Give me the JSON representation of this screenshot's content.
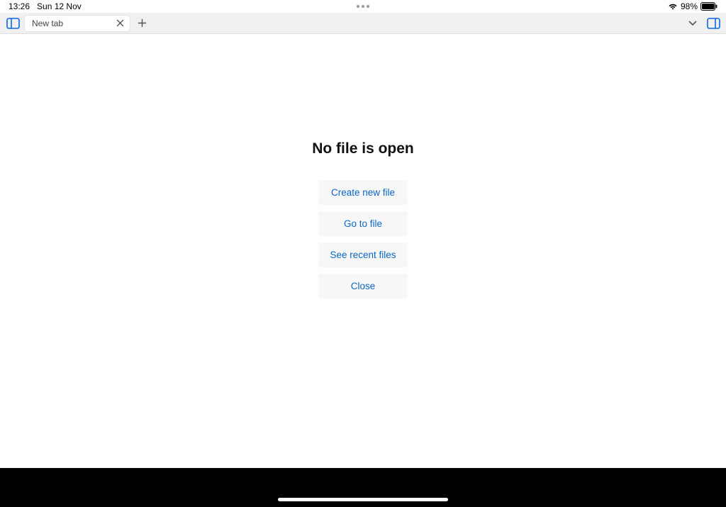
{
  "status": {
    "time": "13:26",
    "date": "Sun 12 Nov",
    "battery_percent": "98%"
  },
  "tabbar": {
    "tab_label": "New tab"
  },
  "empty": {
    "title": "No file is open",
    "create_label": "Create new file",
    "goto_label": "Go to file",
    "recent_label": "See recent files",
    "close_label": "Close"
  }
}
